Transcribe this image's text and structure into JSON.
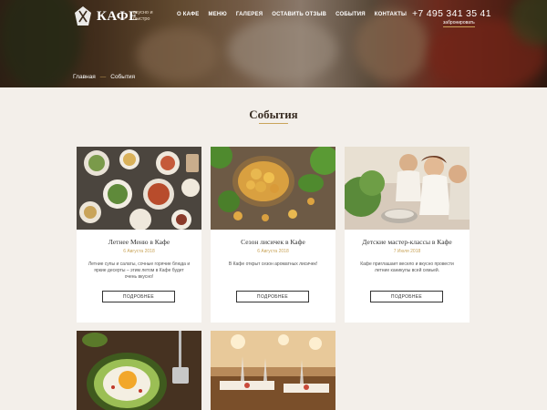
{
  "header": {
    "logo_text": "КАФЕ",
    "logo_tagline": "вкусно и быстро",
    "nav": [
      "О кафе",
      "Меню",
      "Галерея",
      "Оставить отзыв",
      "События",
      "Контакты"
    ],
    "phone": "+7 495 341 35 41",
    "book_label": "забронировать"
  },
  "breadcrumb": {
    "home": "Главная",
    "separator": "—",
    "current": "События"
  },
  "page_title": "События",
  "cards": [
    {
      "title": "Летнее Меню в Кафе",
      "date": "6 Августа 2018",
      "text": "Летние супы и салаты, сочные горячие блюда и яркие десерты – этим летом в Кафе будет очень вкусно!",
      "button": "ПОДРОБНЕЕ"
    },
    {
      "title": "Сезон лисичек в Кафе",
      "date": "6 Августа 2018",
      "text": "В Кафе открыт сезон ароматных лисичек!",
      "button": "ПОДРОБНЕЕ"
    },
    {
      "title": "Детские мастер-классы в Кафе",
      "date": "7 Июля 2018",
      "text": "Кафе приглашает весело и вкусно провести летние каникулы всей семьей.",
      "button": "ПОДРОБНЕЕ"
    }
  ],
  "colors": {
    "accent": "#c9a45a",
    "background": "#f3efea",
    "card": "#ffffff",
    "text": "#333333"
  }
}
